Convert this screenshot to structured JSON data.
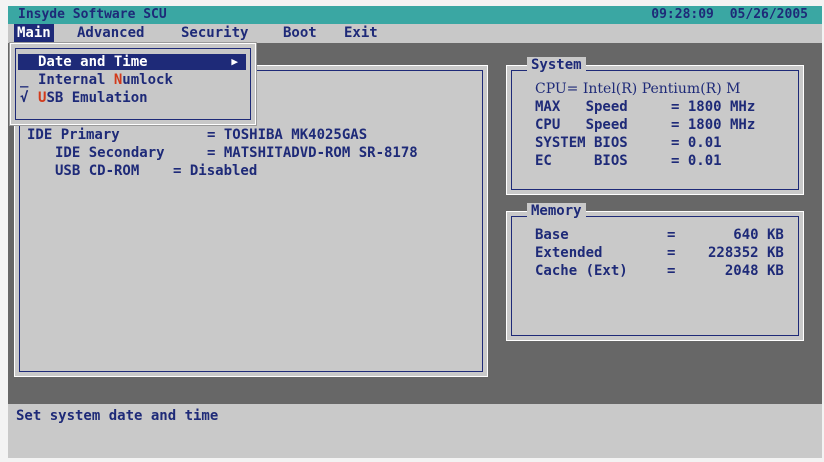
{
  "titlebar": {
    "app_name": "Insyde Software SCU",
    "time": "09:28:09",
    "date": "05/26/2005"
  },
  "menubar": {
    "items": [
      "Main",
      "Advanced",
      "Security",
      "Boot",
      "Exit"
    ],
    "active_index": 0
  },
  "popup": {
    "items": [
      {
        "mark": "",
        "label": "Date and Time",
        "hotkey": "",
        "rest": "",
        "has_submenu": true,
        "arrow": "▶"
      },
      {
        "mark": "_",
        "label": "Internal ",
        "hotkey": "N",
        "rest": "umlock",
        "has_submenu": false,
        "arrow": ""
      },
      {
        "mark": "√",
        "label": "",
        "hotkey": "U",
        "rest": "SB Emulation",
        "has_submenu": false,
        "arrow": ""
      }
    ]
  },
  "main_panel": {
    "partial_lines": [
      {
        "label": "IDE Primary",
        "value": "TOSHIBA MK4025GAS"
      }
    ],
    "lines": [
      {
        "label": "IDE Secondary",
        "value": "MATSHITADVD-ROM SR-8178"
      },
      {
        "label": "USB CD-ROM",
        "value": "Disabled"
      }
    ]
  },
  "system_panel": {
    "title": "System",
    "cpu": "CPU= Intel(R) Pentium(R) M",
    "rows": [
      {
        "label": "MAX   Speed",
        "value": "1800 MHz"
      },
      {
        "label": "CPU   Speed",
        "value": "1800 MHz"
      },
      {
        "label": "SYSTEM BIOS",
        "value": "0.01"
      },
      {
        "label": "EC     BIOS",
        "value": "0.01"
      }
    ]
  },
  "memory_panel": {
    "title": "Memory",
    "rows": [
      {
        "label": "Base",
        "value": "640 KB"
      },
      {
        "label": "Extended",
        "value": "228352 KB"
      },
      {
        "label": "Cache (Ext)",
        "value": "2048 KB"
      }
    ]
  },
  "status": {
    "message": "Set system date and time"
  },
  "colors": {
    "title_bg": "#3aa7a3",
    "text_blue": "#1e2a78",
    "work_bg": "#676767",
    "panel_bg": "#c9c9c9",
    "hotkey": "#d23a1b"
  }
}
